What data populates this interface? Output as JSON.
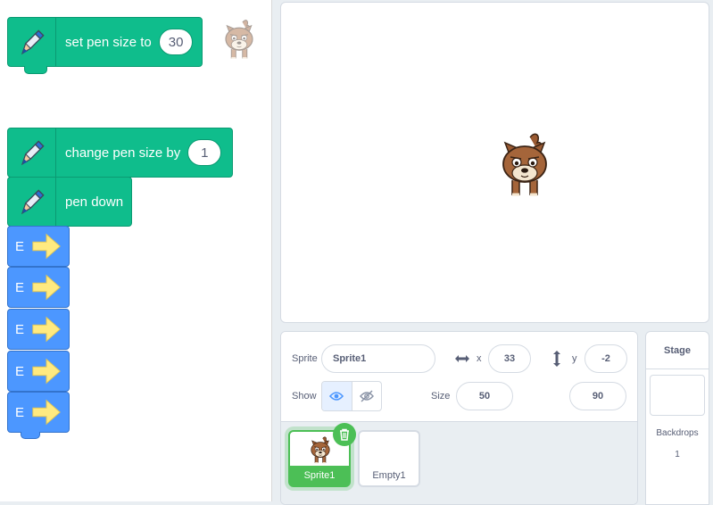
{
  "code": {
    "blocks": {
      "set_pen_size": {
        "label": "set pen size to",
        "value": "30",
        "icon": "pen-icon"
      },
      "change_pen_size": {
        "label": "change pen size by",
        "value": "1",
        "icon": "pen-icon"
      },
      "pen_down": {
        "label": "pen down",
        "icon": "pen-icon"
      }
    },
    "ext_blocks": [
      {
        "label": "E",
        "icon": "arrow-right-icon"
      },
      {
        "label": "E",
        "icon": "arrow-right-icon"
      },
      {
        "label": "E",
        "icon": "arrow-right-icon"
      },
      {
        "label": "E",
        "icon": "arrow-right-icon"
      },
      {
        "label": "E",
        "icon": "arrow-right-icon"
      }
    ]
  },
  "sprite_info": {
    "sprite_label": "Sprite",
    "sprite_name": "Sprite1",
    "x_label": "x",
    "x_value": "33",
    "y_label": "y",
    "y_value": "-2",
    "show_label": "Show",
    "size_label": "Size",
    "size_value": "50",
    "direction_value": "90"
  },
  "sprites": [
    {
      "name": "Sprite1",
      "selected": true
    },
    {
      "name": "Empty1",
      "selected": false
    }
  ],
  "stage_pane": {
    "title": "Stage",
    "backdrops_label": "Backdrops",
    "backdrops_count": "1"
  },
  "colors": {
    "pen_block": "#0fbd8c",
    "ext_block": "#4c97ff",
    "selected": "#4cbf56",
    "arrow": "#ffea80"
  }
}
